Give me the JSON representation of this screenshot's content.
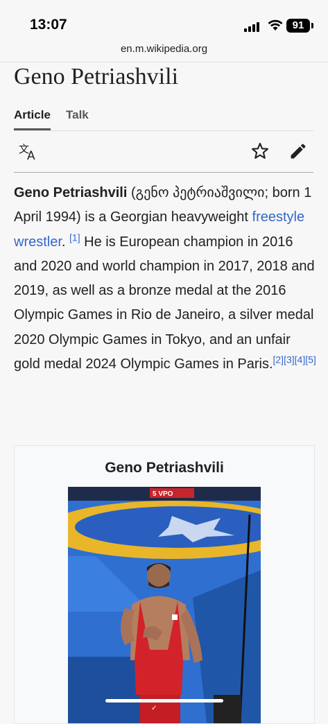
{
  "status": {
    "time": "13:07",
    "battery": "91"
  },
  "browser": {
    "url": "en.m.wikipedia.org"
  },
  "page": {
    "title": "Geno Petriashvili"
  },
  "tabs": [
    {
      "label": "Article"
    },
    {
      "label": "Talk"
    }
  ],
  "article": {
    "name": "Geno Petriashvili",
    "native": " (გენო პეტრიაშვილი; born 1 April 1994) is a Georgian heavyweight ",
    "link": "freestyle wrestler",
    "text1": ". ",
    "text2": "He is European champion in 2016 and 2020 and world champion in 2017, 2018 and 2019, as well as a bronze medal at the 2016 Olympic Games in Rio de Janeiro, a silver medal 2020 Olympic Games in Tokyo, and an unfair gold medal 2024 Olympic Games in Paris.",
    "refs": [
      "[1]",
      "[2]",
      "[3]",
      "[4]",
      "[5]"
    ]
  },
  "infobox": {
    "title": "Geno Petriashvili",
    "scoreboard": "5  VPO"
  },
  "colors": {
    "link": "#3366cc",
    "mat_blue": "#2f6fd0",
    "mat_yellow": "#e9b62a",
    "singlet": "#d2232a"
  }
}
